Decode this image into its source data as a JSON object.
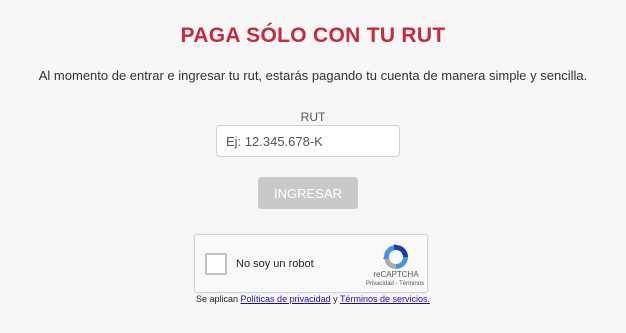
{
  "header": {
    "title": "PAGA SÓLO CON TU RUT",
    "subtitle": "Al momento de entrar e ingresar tu rut, estarás pagando tu cuenta de manera simple y sencilla."
  },
  "form": {
    "rut_label": "RUT",
    "rut_placeholder": "Ej: 12.345.678-K",
    "rut_value": "",
    "submit_label": "INGRESAR"
  },
  "recaptcha": {
    "checkbox_label": "No soy un robot",
    "brand": "reCAPTCHA",
    "privacy": "Privacidad",
    "separator": " - ",
    "terms": "Términos"
  },
  "footer": {
    "prefix": "Se aplican ",
    "privacy_link": "Políticas de privacidad",
    "connector": " y ",
    "terms_link": "Términos de servicios."
  },
  "colors": {
    "title": "#c62a3c",
    "button_disabled": "#c9c9c9",
    "link": "#1a0dab"
  },
  "icons": {
    "recaptcha_logo": "recaptcha-logo-icon"
  }
}
